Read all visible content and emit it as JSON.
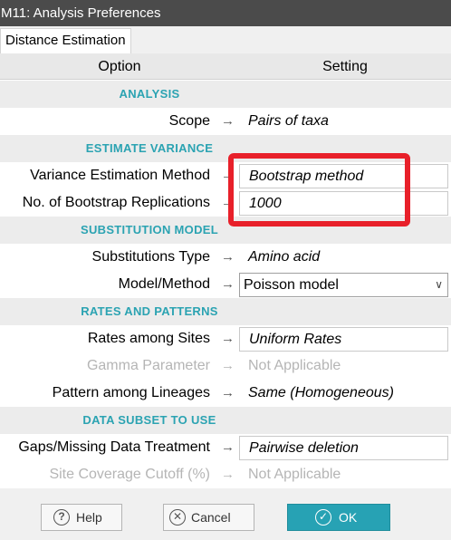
{
  "window": {
    "title": "M11: Analysis Preferences"
  },
  "tabs": [
    {
      "label": "Distance Estimation"
    }
  ],
  "columns": {
    "option": "Option",
    "setting": "Setting"
  },
  "sections": {
    "analysis": "ANALYSIS",
    "estimate_variance": "ESTIMATE VARIANCE",
    "substitution_model": "SUBSTITUTION MODEL",
    "rates_patterns": "RATES AND PATTERNS",
    "data_subset": "DATA SUBSET TO USE"
  },
  "arrow_glyph": "→",
  "rows": {
    "scope": {
      "label": "Scope",
      "value": "Pairs of taxa"
    },
    "variance_method": {
      "label": "Variance Estimation Method",
      "value": "Bootstrap method"
    },
    "bootstrap_reps": {
      "label": "No. of Bootstrap Replications",
      "value": "1000"
    },
    "substitutions_type": {
      "label": "Substitutions Type",
      "value": "Amino acid"
    },
    "model_method": {
      "label": "Model/Method",
      "value": "Poisson model"
    },
    "rates_sites": {
      "label": "Rates among Sites",
      "value": "Uniform Rates"
    },
    "gamma": {
      "label": "Gamma Parameter",
      "value": "Not Applicable"
    },
    "pattern_lineages": {
      "label": "Pattern among Lineages",
      "value": "Same (Homogeneous)"
    },
    "gaps_missing": {
      "label": "Gaps/Missing Data Treatment",
      "value": "Pairwise deletion"
    },
    "site_coverage": {
      "label": "Site Coverage Cutoff (%)",
      "value": "Not Applicable"
    }
  },
  "buttons": {
    "help": "Help",
    "cancel": "Cancel",
    "ok": "OK"
  },
  "colors": {
    "section_title": "#2ba3b2",
    "ok_button": "#27a2b4",
    "highlight": "#e8202a",
    "titlebar": "#4b4b4b"
  }
}
